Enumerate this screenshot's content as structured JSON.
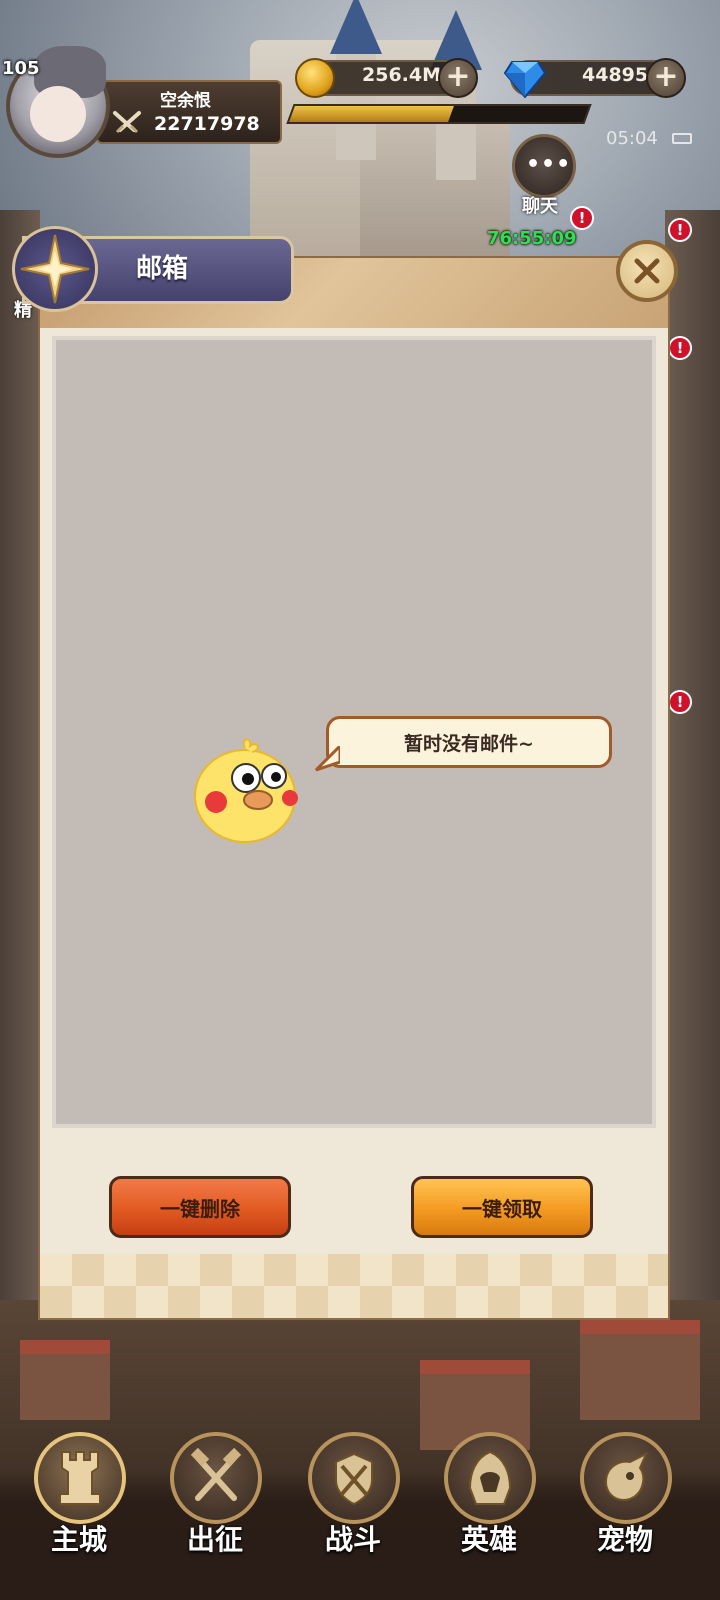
{
  "player": {
    "level": "105",
    "name": "空余恨",
    "power": "22717978"
  },
  "resources": {
    "gold": "256.4M",
    "diamonds": "44895"
  },
  "status": {
    "time": "05:04"
  },
  "chat": {
    "label": "聊天",
    "timer": "76:55:09"
  },
  "side_labels": {
    "left_partial": "精"
  },
  "mail": {
    "title": "邮箱",
    "empty_message": "暂时没有邮件~",
    "delete_all_label": "一键删除",
    "claim_all_label": "一键领取"
  },
  "bottom_nav": {
    "items": [
      {
        "label": "主城"
      },
      {
        "label": "出征"
      },
      {
        "label": "战斗"
      },
      {
        "label": "英雄"
      },
      {
        "label": "宠物"
      }
    ]
  },
  "colors": {
    "gold_accent": "#e0a21c",
    "timer_green": "#2ee04a",
    "alert_red": "#d0112b",
    "delete_button": "#e25a22",
    "claim_button": "#f49a22"
  }
}
